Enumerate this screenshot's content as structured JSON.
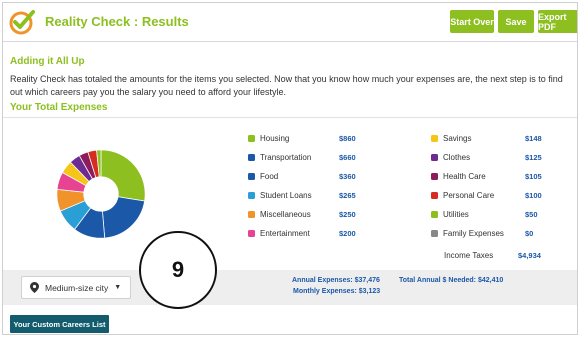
{
  "header": {
    "title": "Reality Check : Results",
    "buttons": [
      "Start Over",
      "Save",
      "Export PDF"
    ]
  },
  "adding": {
    "heading": "Adding it All Up",
    "text": "Reality Check has totaled the amounts for the items you selected. Now that you know how much your expenses are, the next step is to find out which careers pay you the salary you need to afford your lifestyle."
  },
  "expenses": {
    "heading": "Your Total Expenses",
    "left": [
      {
        "label": "Housing",
        "value": "$860",
        "icon": "house-icon",
        "color": "#8cbf1f"
      },
      {
        "label": "Transportation",
        "value": "$660",
        "icon": "car-icon",
        "color": "#1b58a8"
      },
      {
        "label": "Food",
        "value": "$360",
        "icon": "food-icon",
        "color": "#1b58a8"
      },
      {
        "label": "Student Loans",
        "value": "$265",
        "icon": "graduation-cap-icon",
        "color": "#2a9fd6"
      },
      {
        "label": "Miscellaneous",
        "value": "$250",
        "icon": "misc-icon",
        "color": "#f0932b"
      },
      {
        "label": "Entertainment",
        "value": "$200",
        "icon": "ticket-icon",
        "color": "#e84393"
      }
    ],
    "right": [
      {
        "label": "Savings",
        "value": "$148",
        "icon": "piggy-bank-icon",
        "color": "#f5c518"
      },
      {
        "label": "Clothes",
        "value": "$125",
        "icon": "shirt-icon",
        "color": "#6c2c91"
      },
      {
        "label": "Health Care",
        "value": "$105",
        "icon": "medical-kit-icon",
        "color": "#8e1b5c"
      },
      {
        "label": "Personal Care",
        "value": "$100",
        "icon": "lips-icon",
        "color": "#d62d20"
      },
      {
        "label": "Utilities",
        "value": "$50",
        "icon": "lightbulb-icon",
        "color": "#8cbf1f"
      },
      {
        "label": "Family Expenses",
        "value": "$0",
        "icon": "family-icon",
        "color": "#888888"
      }
    ],
    "income_taxes": {
      "label": "Income Taxes",
      "value": "$4,934"
    }
  },
  "footer": {
    "location": "Medium-size city",
    "annual": "Annual Expenses: $37,476",
    "monthly": "Monthly Expenses: $3,123",
    "total": "Total Annual $ Needed: $42,410"
  },
  "callout": "9",
  "careers_button": "Your Custom Careers List"
}
